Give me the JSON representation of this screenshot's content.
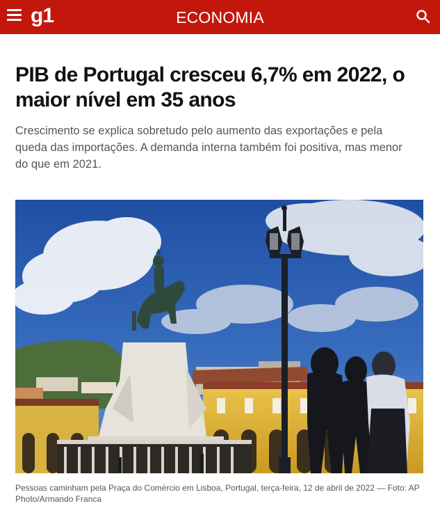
{
  "header": {
    "logo": "g1",
    "section": "ECONOMIA",
    "menu_icon": "hamburger-menu-icon",
    "search_icon": "search-icon",
    "bg_color": "#c4170c"
  },
  "article": {
    "headline": "PIB de Portugal cresceu 6,7% em 2022, o maior nível em 35 anos",
    "subhead": "Crescimento se explica sobretudo pelo aumento das exportações e pela queda das importações. A demanda interna também foi positiva, mas menor do que em 2021.",
    "photo_caption": "Pessoas caminham pela Praça do Comércio em Lisboa, Portugal, terça-feira, 12 de abril de 2022 — Foto: AP Photo/Armando Franca"
  }
}
